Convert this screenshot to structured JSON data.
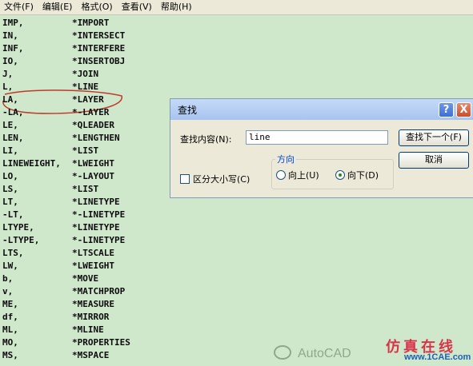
{
  "menu": [
    "文件(F)",
    "编辑(E)",
    "格式(O)",
    "查看(V)",
    "帮助(H)"
  ],
  "rows": [
    [
      "IMP,",
      "*IMPORT"
    ],
    [
      "IN,",
      "*INTERSECT"
    ],
    [
      "INF,",
      "*INTERFERE"
    ],
    [
      "IO,",
      "*INSERTOBJ"
    ],
    [
      "J,",
      "*JOIN"
    ],
    [
      "L,",
      "*LINE"
    ],
    [
      "LA,",
      "*LAYER"
    ],
    [
      "-LA,",
      "*-LAYER"
    ],
    [
      "LE,",
      "*QLEADER"
    ],
    [
      "LEN,",
      "*LENGTHEN"
    ],
    [
      "LI,",
      "*LIST"
    ],
    [
      "LINEWEIGHT,",
      "*LWEIGHT"
    ],
    [
      "LO,",
      "*-LAYOUT"
    ],
    [
      "LS,",
      "*LIST"
    ],
    [
      "LT,",
      "*LINETYPE"
    ],
    [
      "-LT,",
      "*-LINETYPE"
    ],
    [
      "LTYPE,",
      "*LINETYPE"
    ],
    [
      "-LTYPE,",
      "*-LINETYPE"
    ],
    [
      "LTS,",
      "*LTSCALE"
    ],
    [
      "LW,",
      "*LWEIGHT"
    ],
    [
      "b,",
      "*MOVE"
    ],
    [
      "v,",
      "*MATCHPROP"
    ],
    [
      "ME,",
      "*MEASURE"
    ],
    [
      "df,",
      "*MIRROR"
    ],
    [
      "ML,",
      "*MLINE"
    ],
    [
      "MO,",
      "*PROPERTIES"
    ],
    [
      "MS,",
      "*MSPACE"
    ]
  ],
  "find_dialog": {
    "title": "查找",
    "help": "?",
    "close": "X",
    "find_label": "查找内容(N):",
    "find_value": "line",
    "find_next": "查找下一个(F)",
    "cancel": "取消",
    "match_case": "区分大小写(C)",
    "direction": "方向",
    "up": "向上(U)",
    "down": "向下(D)",
    "selected_direction": "down"
  },
  "watermark": {
    "text": "AutoCAD",
    "brand_cn": "仿真在线",
    "brand_url": "www.1CAE.com"
  },
  "colors": {
    "editor_bg": "#cfe8cc",
    "annotation": "#c0392b",
    "brand_red": "#d8344a",
    "brand_blue": "#1f5fb5"
  }
}
